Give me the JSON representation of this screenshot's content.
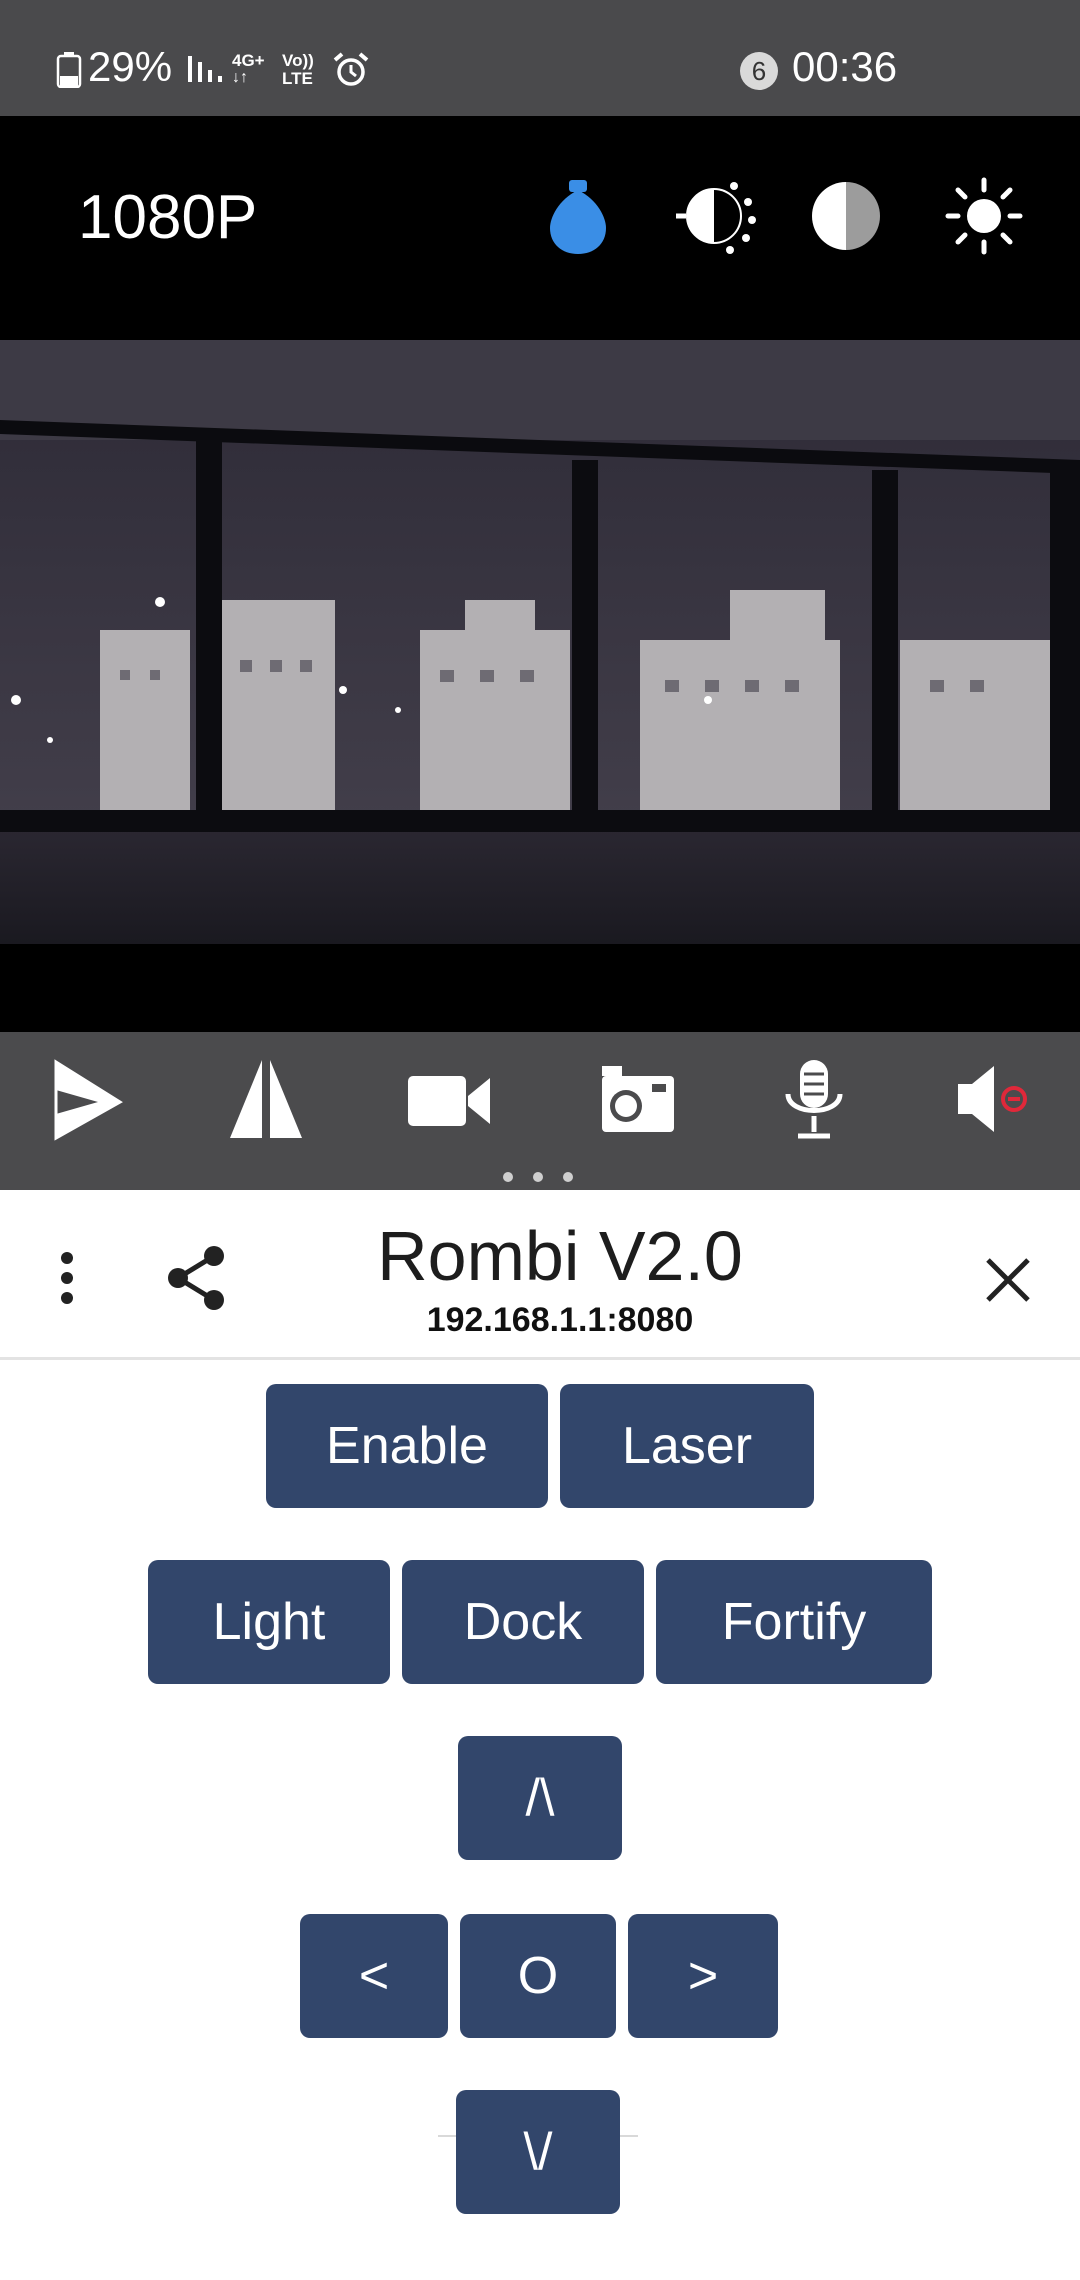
{
  "status_bar": {
    "battery": "29%",
    "network": "4G+",
    "volte": "Vo)) LTE",
    "notification_count": "6",
    "time": "00:36"
  },
  "camera_toolbar": {
    "resolution": "1080P",
    "icons": [
      "bulb-icon",
      "contrast-brightness-icon",
      "contrast-icon",
      "brightness-icon"
    ],
    "bulb_color": "#3a8ee6"
  },
  "media_toolbar": {
    "icons": [
      "play-icon",
      "flip-icon",
      "video-camera-icon",
      "camera-icon",
      "microphone-icon",
      "speaker-muted-icon"
    ],
    "mute_accent": "#e0283a"
  },
  "sheet": {
    "title": "Rombi V2.0",
    "subtitle": "192.168.1.1:8080"
  },
  "controls": {
    "enable": "Enable",
    "laser": "Laser",
    "light": "Light",
    "dock": "Dock",
    "fortify": "Fortify",
    "up": "/\\",
    "left": "<",
    "stop": "O",
    "right": ">",
    "down": "\\/"
  },
  "colors": {
    "button_bg": "#32466b",
    "status_bar_bg": "#4a4a4c",
    "toolbar_bg": "#000000"
  }
}
